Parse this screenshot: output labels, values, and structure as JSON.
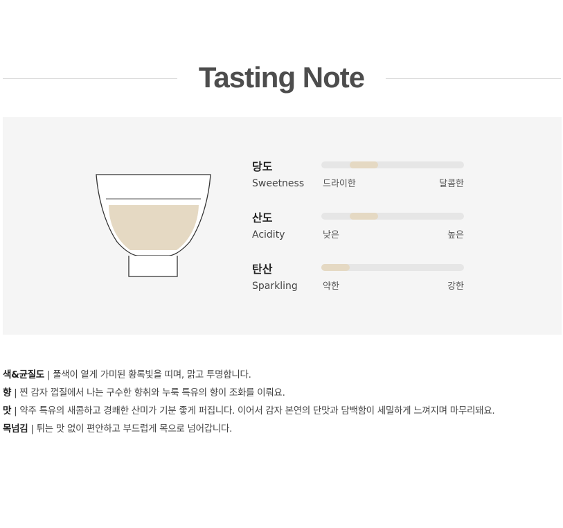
{
  "title": "Tasting Note",
  "attributes": [
    {
      "ko": "당도",
      "en": "Sweetness",
      "low": "드라이한",
      "high": "달콤한",
      "level": {
        "start": 0.2,
        "end": 0.4
      }
    },
    {
      "ko": "산도",
      "en": "Acidity",
      "low": "낮은",
      "high": "높은",
      "level": {
        "start": 0.2,
        "end": 0.4
      }
    },
    {
      "ko": "탄산",
      "en": "Sparkling",
      "low": "약한",
      "high": "강한",
      "level": {
        "start": 0.0,
        "end": 0.2
      }
    }
  ],
  "notes": [
    {
      "key": "색&균질도",
      "sep": " | ",
      "text": "풀색이 옅게 가미된 황록빛을 띠며, 맑고 투명합니다."
    },
    {
      "key": "향",
      "sep": " | ",
      "text": "찐 감자 껍질에서 나는 구수한 향취와 누룩 특유의 향이 조화를 이뤄요."
    },
    {
      "key": "맛",
      "sep": " | ",
      "text": "약주 특유의 새콤하고 경쾌한 산미가 기분 좋게 퍼집니다. 이어서 감자 본연의 단맛과 담백함이 세밀하게 느껴지며 마무리돼요."
    },
    {
      "key": "목넘김",
      "sep": " | ",
      "text": "튀는 맛 없이 편안하고 부드럽게 목으로 넘어갑니다."
    }
  ],
  "colors": {
    "fill": "#e5d9c3",
    "track": "#e6e6e6",
    "panel": "#f5f5f5",
    "title": "#4d4d4d"
  },
  "icons": {
    "cup": "tea-cup-icon"
  }
}
